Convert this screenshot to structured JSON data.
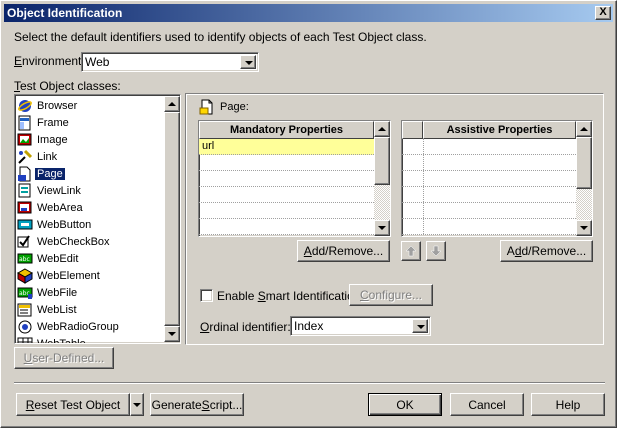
{
  "window": {
    "title": "Object Identification",
    "close_label": "X"
  },
  "intro_text": "Select the default identifiers used to identify objects of each Test Object class.",
  "environment": {
    "label_prefix": "",
    "label_u": "E",
    "label_rest": "nvironment:",
    "value": "Web"
  },
  "classes": {
    "label_u": "T",
    "label_rest": "est Object classes:",
    "items": [
      {
        "label": "Browser",
        "icon": "browser-icon"
      },
      {
        "label": "Frame",
        "icon": "frame-icon"
      },
      {
        "label": "Image",
        "icon": "image-icon"
      },
      {
        "label": "Link",
        "icon": "link-icon"
      },
      {
        "label": "Page",
        "icon": "page-icon",
        "selected": true
      },
      {
        "label": "ViewLink",
        "icon": "viewlink-icon"
      },
      {
        "label": "WebArea",
        "icon": "webarea-icon"
      },
      {
        "label": "WebButton",
        "icon": "webbutton-icon"
      },
      {
        "label": "WebCheckBox",
        "icon": "webcheckbox-icon"
      },
      {
        "label": "WebEdit",
        "icon": "webedit-icon"
      },
      {
        "label": "WebElement",
        "icon": "webelement-icon"
      },
      {
        "label": "WebFile",
        "icon": "webfile-icon"
      },
      {
        "label": "WebList",
        "icon": "weblist-icon"
      },
      {
        "label": "WebRadioGroup",
        "icon": "webradiogroup-icon"
      },
      {
        "label": "WebTable",
        "icon": "webtable-icon"
      }
    ]
  },
  "user_defined_label_u": "U",
  "user_defined_label_rest": "ser-Defined...",
  "selected_class_label": "Page:",
  "mandatory": {
    "header": "Mandatory Properties",
    "rows": [
      "url"
    ],
    "add_remove_u": "A",
    "add_remove_rest": "dd/Remove..."
  },
  "assistive": {
    "header": "Assistive Properties",
    "rows": [],
    "add_remove_prefix": "A",
    "add_remove_u": "d",
    "add_remove_rest": "d/Remove..."
  },
  "smart_id": {
    "label_prefix": "Enable ",
    "label_u": "S",
    "label_rest": "mart Identification",
    "checked": false,
    "configure_u": "C",
    "configure_rest": "onfigure..."
  },
  "ordinal": {
    "label_u": "O",
    "label_rest": "rdinal identifier:",
    "value": "Index"
  },
  "footer": {
    "reset_u": "R",
    "reset_rest": "eset Test Object",
    "generate_prefix": "Generate ",
    "generate_u": "S",
    "generate_rest": "cript...",
    "ok": "OK",
    "cancel": "Cancel",
    "help": "Help"
  },
  "colors": {
    "title_start": "#0a246a",
    "title_end": "#a6caf0",
    "face": "#d4d0c8",
    "highlight_row": "#ffff99",
    "selection": "#0a246a"
  }
}
